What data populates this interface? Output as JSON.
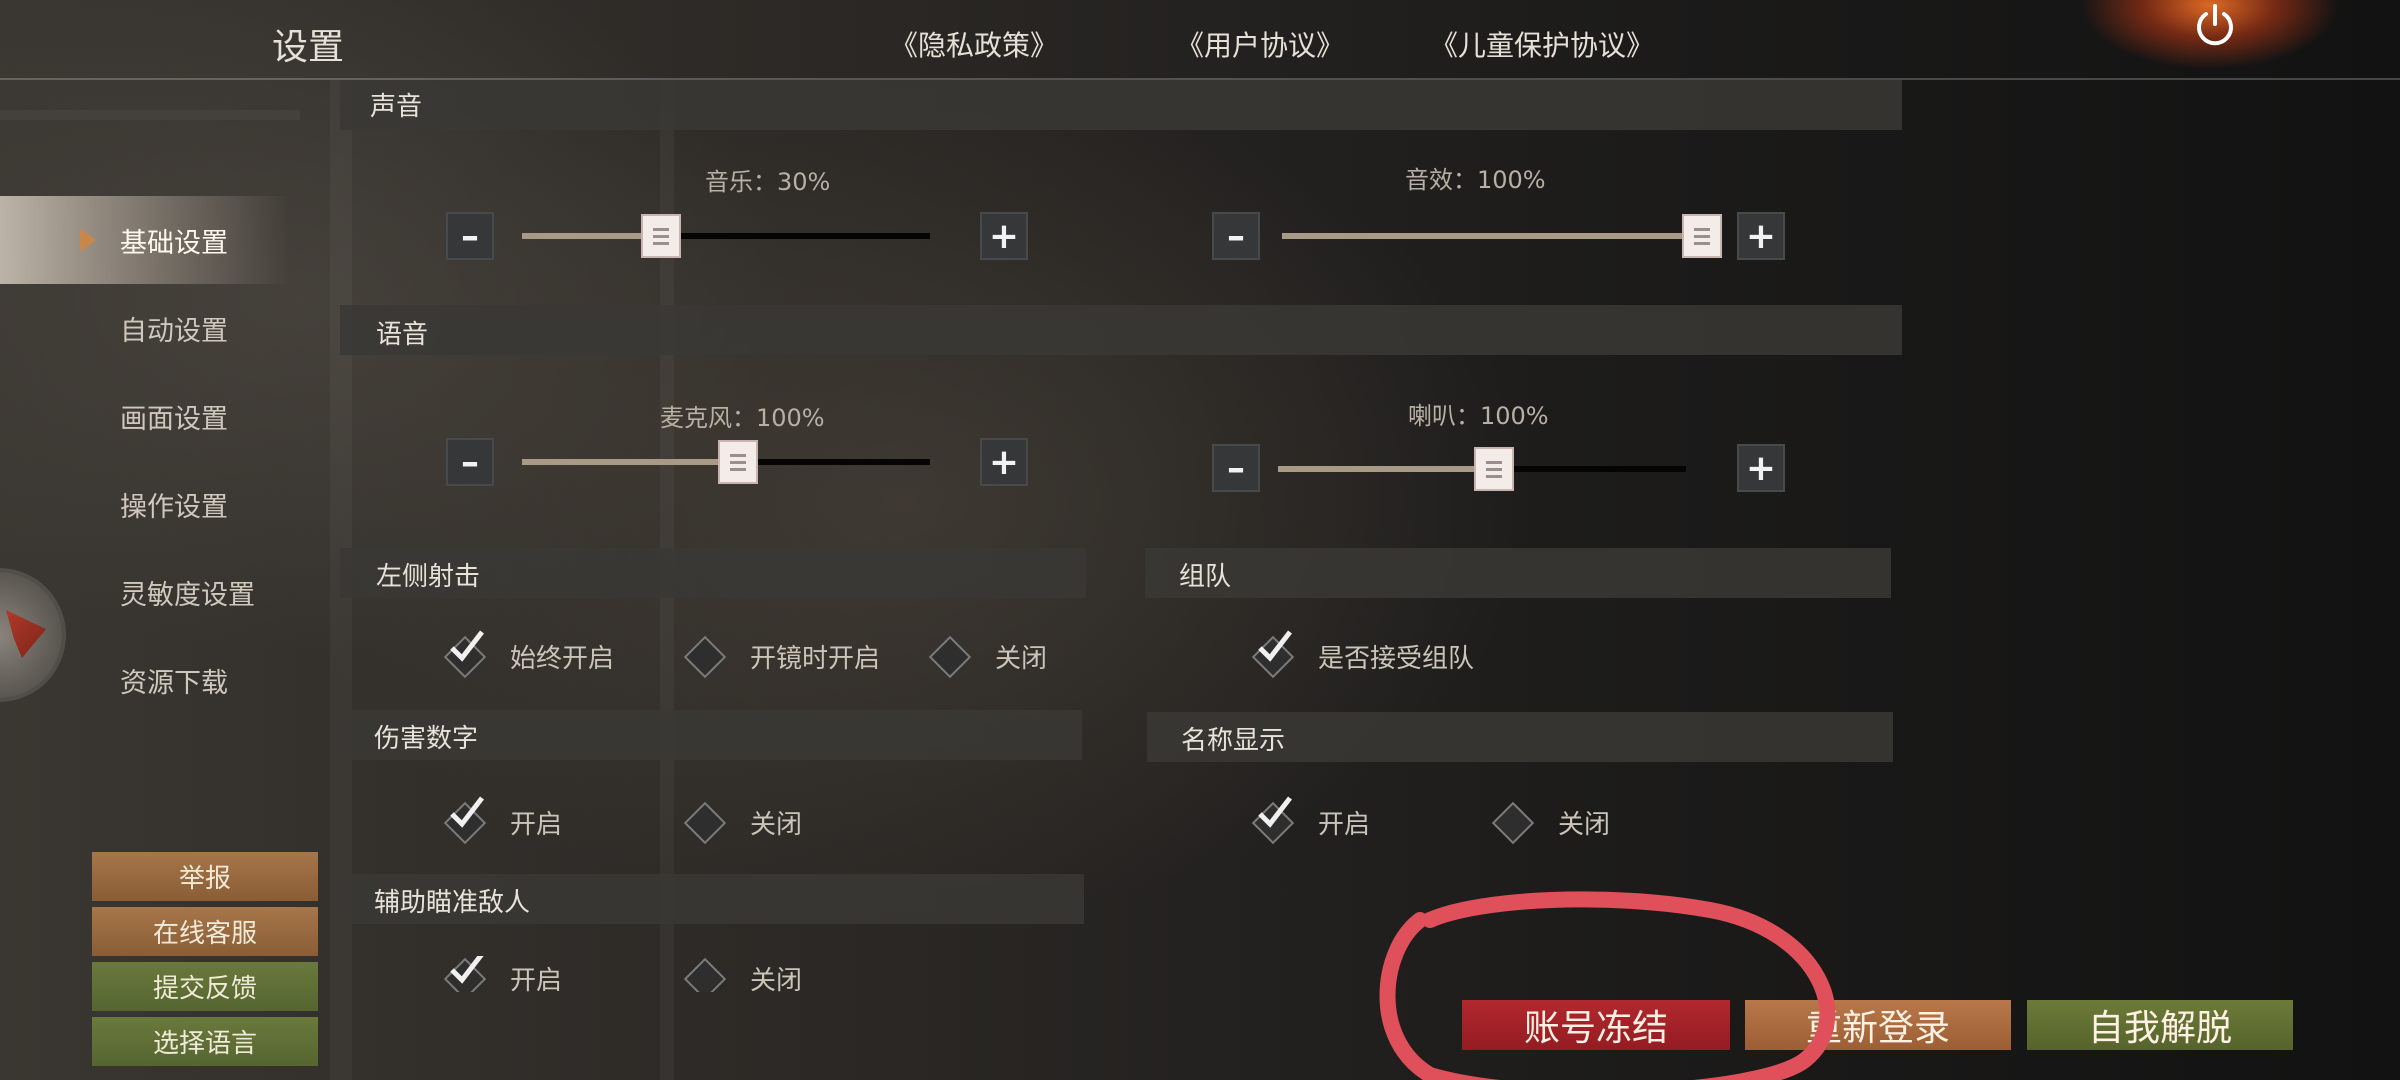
{
  "header": {
    "title": "设置",
    "links": [
      "《隐私政策》",
      "《用户协议》",
      "《儿童保护协议》"
    ]
  },
  "nav": {
    "items": [
      {
        "label": "基础设置",
        "active": true
      },
      {
        "label": "自动设置",
        "active": false
      },
      {
        "label": "画面设置",
        "active": false
      },
      {
        "label": "操作设置",
        "active": false
      },
      {
        "label": "灵敏度设置",
        "active": false
      },
      {
        "label": "资源下载",
        "active": false
      }
    ]
  },
  "side_buttons": [
    "举报",
    "在线客服",
    "提交反馈",
    "选择语言"
  ],
  "sections": {
    "sound": {
      "title": "声音"
    },
    "voice": {
      "title": "语音"
    },
    "left_fire": {
      "title": "左侧射击",
      "options": [
        "始终开启",
        "开镜时开启",
        "关闭"
      ],
      "selected": 0
    },
    "team": {
      "title": "组队",
      "options": [
        "是否接受组队"
      ],
      "selected": 0
    },
    "damage_numbers": {
      "title": "伤害数字",
      "options": [
        "开启",
        "关闭"
      ],
      "selected": 0
    },
    "name_display": {
      "title": "名称显示",
      "options": [
        "开启",
        "关闭"
      ],
      "selected": 0
    },
    "aim_assist": {
      "title": "辅助瞄准敌人",
      "options": [
        "开启",
        "关闭"
      ],
      "selected": 0
    }
  },
  "sliders": {
    "music": {
      "label": "音乐：30%",
      "level": 0.34
    },
    "sfx": {
      "label": "音效：100%",
      "level": 1.0
    },
    "mic": {
      "label": "麦克风：100%",
      "level": 0.53
    },
    "speaker": {
      "label": "喇叭：100%",
      "level": 0.53
    },
    "minus_symbol": "–",
    "plus_symbol": "+"
  },
  "bottom_buttons": {
    "freeze": "账号冻结",
    "relogin": "重新登录",
    "self_release": "自我解脱"
  },
  "icons": {
    "power": "power-icon",
    "nav_arrow": "triangle-right-icon",
    "check": "checkmark-icon"
  },
  "colors": {
    "accent_orange": "#c9874a",
    "freeze_red": "#b2282e",
    "annotation_red": "#e0505a",
    "green_button": "#6c7a38"
  }
}
